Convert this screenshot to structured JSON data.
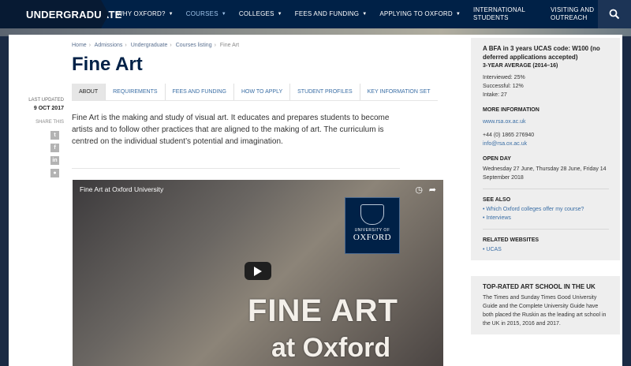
{
  "nav": {
    "brand": "UNDERGRADUATE",
    "items": [
      {
        "label": "WHY OXFORD?",
        "active": false
      },
      {
        "label": "COURSES",
        "active": true
      },
      {
        "label": "COLLEGES",
        "active": false
      },
      {
        "label": "FEES AND FUNDING",
        "active": false
      },
      {
        "label": "APPLYING TO OXFORD",
        "active": false
      },
      {
        "label": "INTERNATIONAL STUDENTS",
        "active": false
      },
      {
        "label": "VISITING AND OUTREACH",
        "active": false
      }
    ],
    "search_icon": "search-icon"
  },
  "breadcrumb": [
    "Home",
    "Admissions",
    "Undergraduate",
    "Courses listing",
    "Fine Art"
  ],
  "page_title": "Fine Art",
  "meta": {
    "last_updated_label": "LAST UPDATED",
    "last_updated": "9 OCT 2017",
    "share_label": "SHARE THIS"
  },
  "share_icons": [
    "twitter-icon",
    "facebook-icon",
    "linkedin-icon",
    "reddit-icon"
  ],
  "tabs": [
    "ABOUT",
    "REQUIREMENTS",
    "FEES AND FUNDING",
    "HOW TO APPLY",
    "STUDENT PROFILES",
    "KEY INFORMATION SET"
  ],
  "intro": "Fine Art is the making and study of visual art. It educates and prepares students to become artists and to follow other practices that are aligned to the making of art. The curriculum is centred on the individual student’s potential and imagination.",
  "video": {
    "title": "Fine Art at Oxford University",
    "overlay_line1": "FINE ART",
    "overlay_line2": "at Oxford",
    "logo_small": "UNIVERSITY OF",
    "logo_big": "OXFORD"
  },
  "sidebar": {
    "course_title": "A BFA in 3 years UCAS code: W100 (no deferred applications accepted)",
    "average_label": "3-YEAR AVERAGE (2014–16)",
    "stats": [
      "Interviewed: 25%",
      "Successful: 12%",
      "Intake: 27"
    ],
    "more_info_label": "MORE INFORMATION",
    "more_info_link": "www.rsa.ox.ac.uk",
    "phone": "+44 (0) 1865 276940",
    "email": "info@rsa.ox.ac.uk",
    "open_day_label": "OPEN DAY",
    "open_day_text": "Wednesday 27 June, Thursday 28 June, Friday 14 September 2018",
    "see_also_label": "SEE ALSO",
    "see_also": [
      "Which Oxford colleges offer my course?",
      "Interviews"
    ],
    "related_label": "RELATED WEBSITES",
    "related": [
      "UCAS"
    ],
    "promo_title": "TOP-RATED ART SCHOOL IN THE UK",
    "promo_text": "The Times and Sunday Times Good University Guide and the Complete University Guide have both placed the Ruskin as the leading art school in the UK in 2015, 2016 and 2017."
  }
}
